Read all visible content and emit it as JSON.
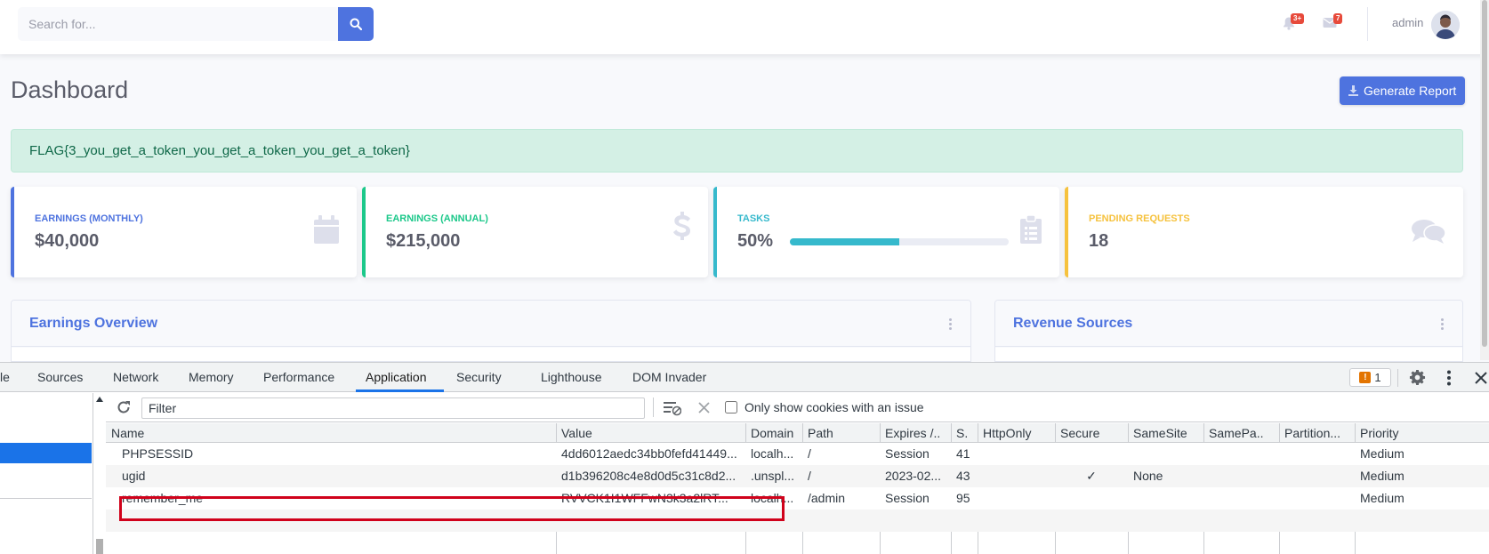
{
  "search": {
    "placeholder": "Search for..."
  },
  "topbar": {
    "alerts_badge": "3+",
    "messages_badge": "7",
    "user_name": "admin"
  },
  "page": {
    "title": "Dashboard",
    "generate_report_label": "Generate Report"
  },
  "alert": {
    "text": "FLAG{3_you_get_a_token_you_get_a_token_you_get_a_token}"
  },
  "cards": [
    {
      "label": "Earnings (Monthly)",
      "value": "$40,000",
      "color": "#4e73df",
      "icon": "calendar-icon"
    },
    {
      "label": "Earnings (Annual)",
      "value": "$215,000",
      "color": "#1cc88a",
      "icon": "dollar-icon"
    },
    {
      "label": "Tasks",
      "value": "50%",
      "color": "#36b9cc",
      "icon": "clipboard-icon",
      "progress": 0.5
    },
    {
      "label": "Pending Requests",
      "value": "18",
      "color": "#f6c23e",
      "icon": "comments-icon"
    }
  ],
  "panels": {
    "earnings_title": "Earnings Overview",
    "revenue_title": "Revenue Sources"
  },
  "devtools": {
    "tabs": [
      "le",
      "Sources",
      "Network",
      "Memory",
      "Performance",
      "Application",
      "Security",
      "Lighthouse",
      "DOM Invader"
    ],
    "active_tab": "Application",
    "issues_count": "1",
    "filter_placeholder": "Filter",
    "only_issues_label": "Only show cookies with an issue",
    "columns": [
      "Name",
      "Value",
      "Domain",
      "Path",
      "Expires /..",
      "S.",
      "HttpOnly",
      "Secure",
      "SameSite",
      "SamePa..",
      "Partition...",
      "Priority"
    ],
    "rows": [
      {
        "name": "PHPSESSID",
        "value": "4dd6012aedc34bb0fefd41449...",
        "domain": "localh...",
        "path": "/",
        "expires": "Session",
        "size": "41",
        "httponly": "",
        "secure": "",
        "samesite": "",
        "sameparty": "",
        "partition": "",
        "priority": "Medium"
      },
      {
        "name": "ugid",
        "value": "d1b396208c4e8d0d5c31c8d2...",
        "domain": ".unspl...",
        "path": "/",
        "expires": "2023-02...",
        "size": "43",
        "httponly": "",
        "secure": "✓",
        "samesite": "None",
        "sameparty": "",
        "partition": "",
        "priority": "Medium"
      },
      {
        "name": "remember_me",
        "value": "RVVCK1I1WFFwN3k3a2lRT...",
        "domain": "localh...",
        "path": "/admin",
        "expires": "Session",
        "size": "95",
        "httponly": "",
        "secure": "",
        "samesite": "",
        "sameparty": "",
        "partition": "",
        "priority": "Medium"
      }
    ],
    "highlight_color": "#d0021b"
  }
}
